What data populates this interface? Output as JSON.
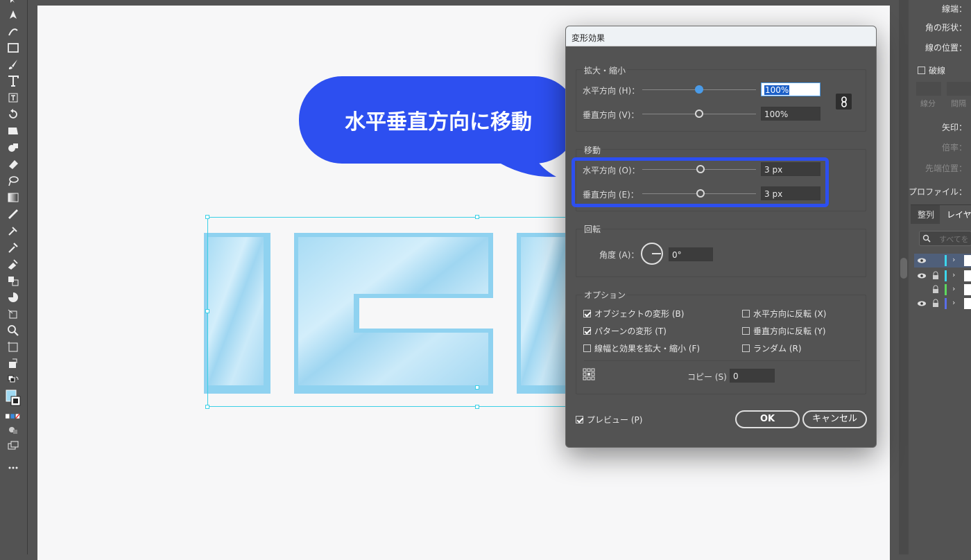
{
  "toolbar": {
    "tools": [
      "selection-tool",
      "pen-tool",
      "curvature-tool",
      "rectangle-tool",
      "paintbrush-tool",
      "type-tool",
      "area-type-tool",
      "rotate-tool",
      "warp-tool",
      "shape-builder-tool",
      "eraser-tool",
      "lasso-tool",
      "gradient-tool",
      "blend-tool",
      "symbol-sprayer-tool",
      "eyedropper-tool",
      "live-paint-tool",
      "graph-tool",
      "pie-tool",
      "slice-tool",
      "zoom-tool",
      "artboard-tool",
      "perspective-tool"
    ]
  },
  "right_panel": {
    "line_end_label": "線端：",
    "corner_label": "角の形状：",
    "align_stroke_label": "線の位置：",
    "dashed_label": "破線",
    "dash_label": "線分",
    "gap_label": "間隔",
    "arrow_label": "矢印：",
    "scale_label": "倍率：",
    "tip_label": "先端位置：",
    "profile_label": "プロファイル：",
    "tabs": [
      "整列",
      "レイヤー"
    ],
    "search_placeholder": "すべてを"
  },
  "callout": {
    "text": "水平垂直方向に移動"
  },
  "dialog": {
    "title": "変形効果",
    "scale_group": {
      "title": "拡大・縮小",
      "horizontal_label": "水平方向 (H)：",
      "horizontal_value": "100%",
      "vertical_label": "垂直方向 (V)：",
      "vertical_value": "100%"
    },
    "move_group": {
      "title": "移動",
      "horizontal_label": "水平方向 (O)：",
      "horizontal_value": "3 px",
      "vertical_label": "垂直方向 (E)：",
      "vertical_value": "3 px"
    },
    "rotate_group": {
      "title": "回転",
      "angle_label": "角度 (A)：",
      "angle_value": "0°"
    },
    "options_group": {
      "title": "オプション",
      "transform_objects": "オブジェクトの変形 (B)",
      "transform_patterns": "パターンの変形 (T)",
      "scale_strokes": "線幅と効果を拡大・縮小 (F)",
      "reflect_x": "水平方向に反転 (X)",
      "reflect_y": "垂直方向に反転 (Y)",
      "random": "ランダム (R)",
      "copies_label": "コピー (S)",
      "copies_value": "0"
    },
    "preview_label": "プレビュー (P)",
    "ok_label": "OK",
    "cancel_label": "キャンセル"
  },
  "colors": {
    "accent": "#2d4ff0",
    "selection": "#3bd0e6",
    "artwork": "#9fd9f2"
  }
}
